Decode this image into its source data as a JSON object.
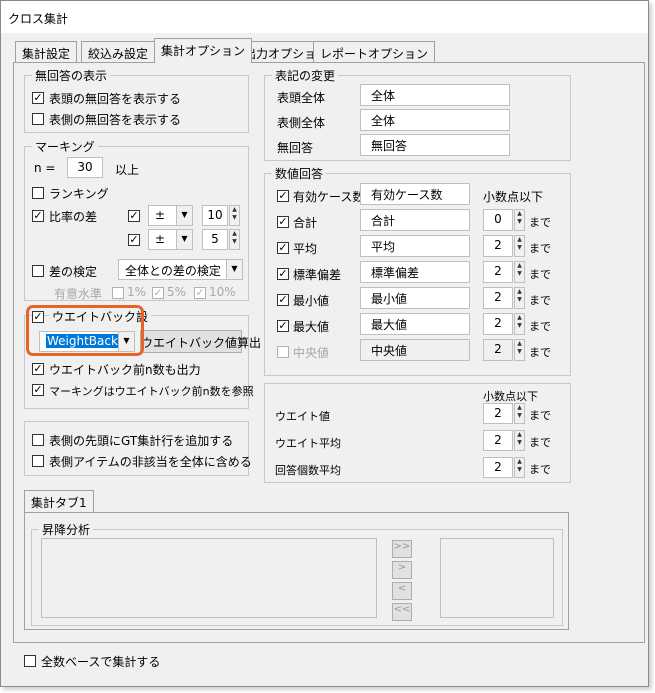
{
  "window": {
    "title": "クロス集計"
  },
  "tabs": [
    "集計設定",
    "絞込み設定",
    "集計オプション",
    "出力オプション",
    "レポートオプション"
  ],
  "no_answer": {
    "title": "無回答の表示",
    "show_head": "表頭の無回答を表示する",
    "show_side": "表側の無回答を表示する"
  },
  "marking": {
    "title": "マーキング",
    "n_label": "n =",
    "n_value": "30",
    "n_suffix": "以上",
    "ranking": "ランキング",
    "ratio_diff": "比率の差",
    "pm": "±",
    "diff1": "10",
    "diff2": "5",
    "test_label": "差の検定",
    "test_value": "全体との差の検定",
    "sig_label": "有意水準",
    "sig1": "1%",
    "sig5": "5%",
    "sig10": "10%"
  },
  "weight": {
    "label": "ウエイトバック設",
    "select": "WeightBack",
    "calc_button": "ウエイトバック値算出",
    "before_n": "ウエイトバック前n数も出力",
    "marking_before": "マーキングはウエイトバック前n数を参照"
  },
  "extra": {
    "gt_row": "表側の先頭にGT集計行を追加する",
    "non_applicable": "表側アイテムの非該当を全体に含める"
  },
  "notation": {
    "title": "表記の変更",
    "rows": [
      {
        "label": "表頭全体",
        "value": "全体"
      },
      {
        "label": "表側全体",
        "value": "全体"
      },
      {
        "label": "無回答",
        "value": "無回答"
      }
    ]
  },
  "numeric": {
    "title": "数値回答",
    "decimals_header": "小数点以下",
    "made": "まで",
    "rows": [
      {
        "label": "有効ケース数",
        "value": "有効ケース数",
        "decimals": "",
        "checked": true
      },
      {
        "label": "合計",
        "value": "合計",
        "decimals": "0",
        "checked": true
      },
      {
        "label": "平均",
        "value": "平均",
        "decimals": "2",
        "checked": true
      },
      {
        "label": "標準偏差",
        "value": "標準偏差",
        "decimals": "2",
        "checked": true
      },
      {
        "label": "最小値",
        "value": "最小値",
        "decimals": "2",
        "checked": true
      },
      {
        "label": "最大値",
        "value": "最大値",
        "decimals": "2",
        "checked": true
      },
      {
        "label": "中央値",
        "value": "中央値",
        "decimals": "2",
        "checked": false
      }
    ]
  },
  "weight_decimals": {
    "header": "小数点以下",
    "made": "まで",
    "rows": [
      {
        "label": "ウエイト値",
        "value": "2"
      },
      {
        "label": "ウエイト平均",
        "value": "2"
      },
      {
        "label": "回答個数平均",
        "value": "2"
      }
    ]
  },
  "bottom_tab": {
    "label": "集計タブ1",
    "group": "昇降分析",
    "buttons": [
      ">>",
      ">",
      "<",
      "<<"
    ]
  },
  "footer": {
    "all_base": "全数ベースで集計する"
  }
}
